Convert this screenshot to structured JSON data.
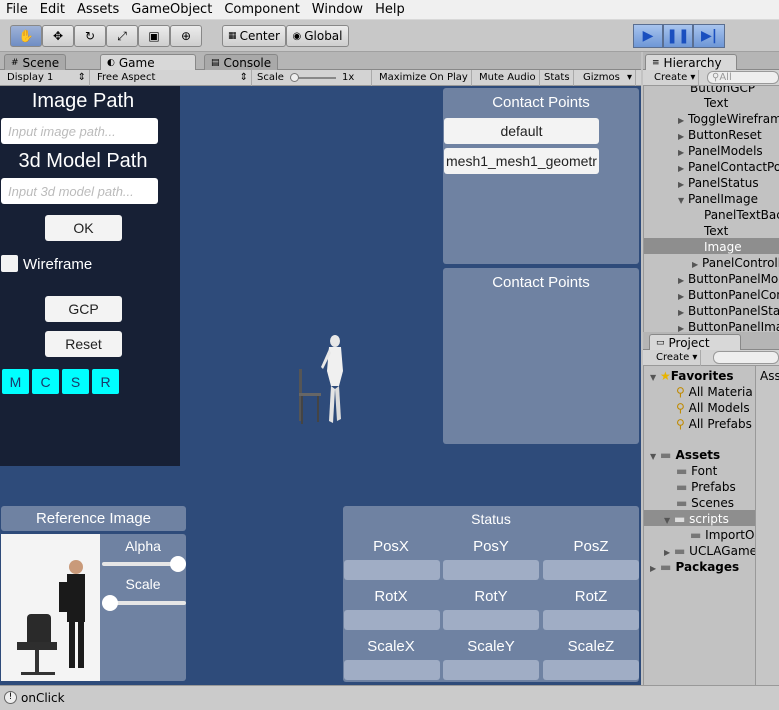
{
  "menu": [
    "File",
    "Edit",
    "Assets",
    "GameObject",
    "Component",
    "Window",
    "Help"
  ],
  "toolbar": {
    "pivot": "Center",
    "space": "Global"
  },
  "tabs": {
    "scene": "Scene",
    "game": "Game",
    "console": "Console",
    "hierarchy": "Hierarchy",
    "project": "Project"
  },
  "gamebar": {
    "display": "Display 1",
    "aspect": "Free Aspect",
    "scale_label": "Scale",
    "scale_value": "1x",
    "maximize": "Maximize On Play",
    "mute": "Mute Audio",
    "stats": "Stats",
    "gizmos": "Gizmos"
  },
  "left_panel": {
    "image_path_title": "Image Path",
    "image_path_placeholder": "Input image path...",
    "model_path_title": "3d Model Path",
    "model_path_placeholder": "Input 3d model path...",
    "ok": "OK",
    "wireframe": "Wireframe",
    "gcp": "GCP",
    "reset": "Reset",
    "mode_buttons": [
      "M",
      "C",
      "S",
      "R"
    ]
  },
  "contact_panel_1": {
    "title": "Contact Points",
    "items": [
      "default",
      "mesh1_mesh1_geometr"
    ]
  },
  "contact_panel_2": {
    "title": "Contact Points"
  },
  "reference": {
    "title": "Reference Image",
    "alpha": "Alpha",
    "scale": "Scale",
    "alpha_value": 1.0,
    "scale_value": 0.0
  },
  "status_panel": {
    "title": "Status",
    "labels": [
      "PosX",
      "PosY",
      "PosZ",
      "RotX",
      "RotY",
      "RotZ",
      "ScaleX",
      "ScaleY",
      "ScaleZ"
    ]
  },
  "hierarchy": {
    "create": "Create",
    "search_placeholder": "All",
    "rows": [
      "ButtonGCP",
      "Text",
      "ToggleWirefram",
      "ButtonReset",
      "PanelModels",
      "PanelContactPo",
      "PanelStatus",
      "PanelImage",
      "PanelTextBac",
      "Text",
      "Image",
      "PanelControll",
      "ButtonPanelMod",
      "ButtonPanelCon",
      "ButtonPanelStat",
      "ButtonPanelIma"
    ]
  },
  "project": {
    "create": "Create",
    "favorites": "Favorites",
    "fav_items": [
      "All Materia",
      "All Models",
      "All Prefabs"
    ],
    "assets": "Assets",
    "asset_items": [
      "Font",
      "Prefabs",
      "Scenes",
      "scripts",
      "ImportO",
      "UCLAGame"
    ],
    "packages": "Packages",
    "right_col": "Ass"
  },
  "status": {
    "message": "onClick"
  }
}
